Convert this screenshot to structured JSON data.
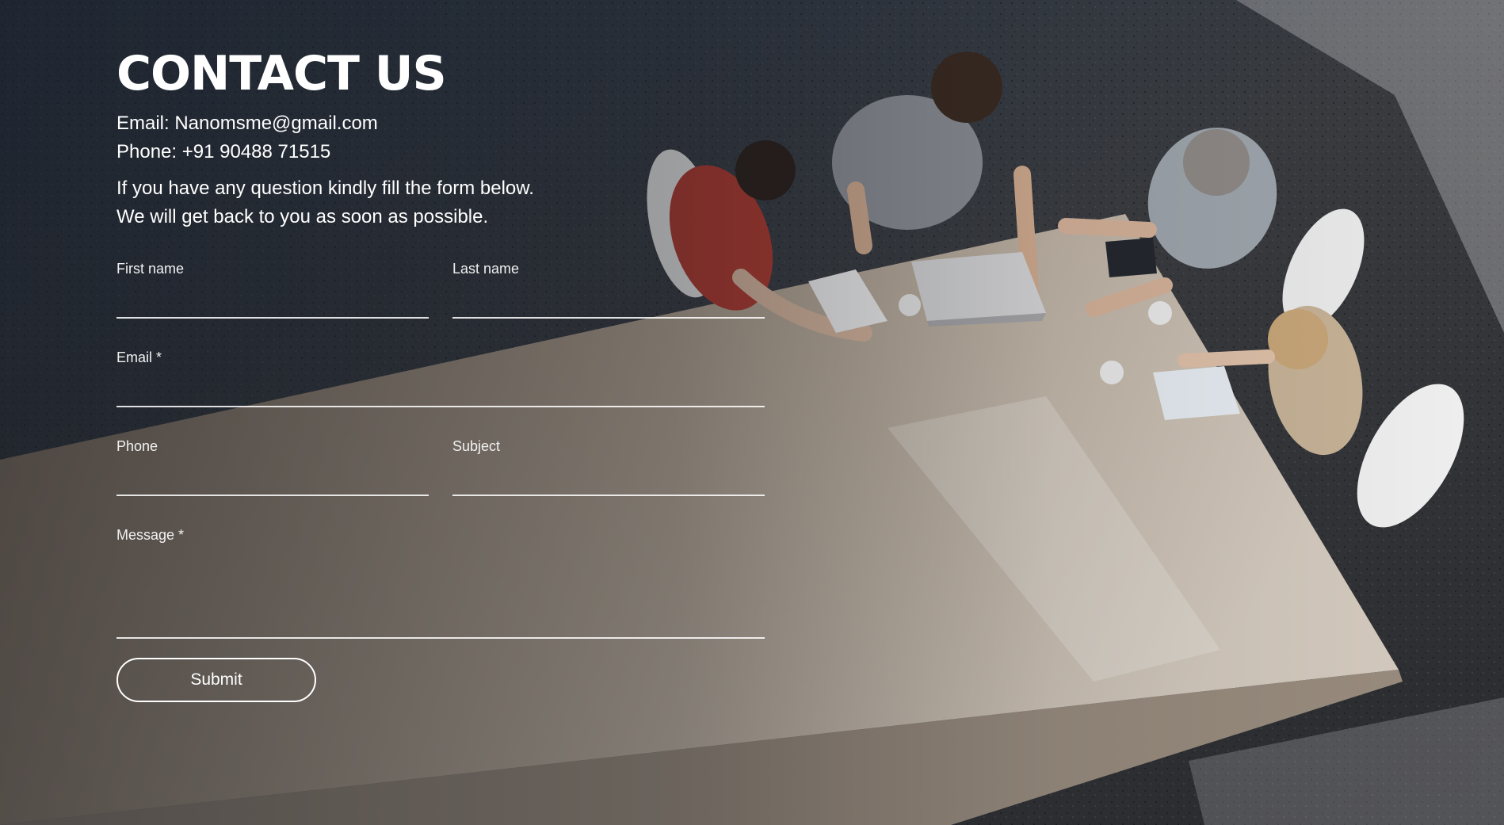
{
  "header": {
    "title": "CONTACT US"
  },
  "contact": {
    "email_line": "Email: Nanomsme@gmail.com",
    "phone_line": "Phone: +91 90488 71515"
  },
  "intro": {
    "line1": "If you have any question kindly fill the form below.",
    "line2": "We will get back to you as soon as possible."
  },
  "form": {
    "first_name_label": "First name",
    "last_name_label": "Last name",
    "email_label": "Email *",
    "phone_label": "Phone",
    "subject_label": "Subject",
    "message_label": "Message *",
    "first_name_value": "",
    "last_name_value": "",
    "email_value": "",
    "phone_value": "",
    "subject_value": "",
    "message_value": "",
    "submit_label": "Submit"
  },
  "colors": {
    "text": "#ffffff",
    "floor": "#2f3135",
    "table": "#bfb3a4"
  }
}
